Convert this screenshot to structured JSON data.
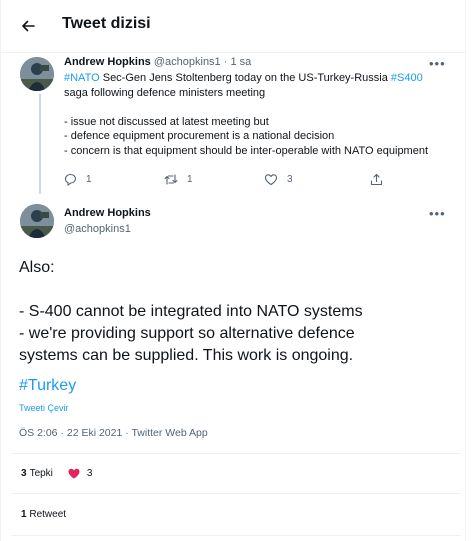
{
  "header": {
    "title": "Tweet dizisi"
  },
  "tweet1": {
    "author_name": "Andrew Hopkins",
    "handle": "@achopkins1",
    "separator": "·",
    "time": "1 sa",
    "line1_tag1": "#NATO",
    "line1_mid": " Sec-Gen Jens Stoltenberg today on the US-Turkey-Russia ",
    "line1_tag2": "#S400",
    "line2": "saga following defence ministers meeting",
    "line3": "- issue not discussed at latest meeting but",
    "line4": "- defence equipment procurement is a national decision",
    "line5": "- concern is that equipment should be inter-operable with NATO equipment",
    "reply_count": "1",
    "retweet_count": "1",
    "like_count": "3"
  },
  "tweet2": {
    "author_name": "Andrew Hopkins",
    "handle": "@achopkins1",
    "line1": "Also:",
    "line2": "- S-400 cannot be integrated into NATO systems",
    "line3": "- we're providing support so alternative defence",
    "line4": "systems can be supplied. This work is ongoing.",
    "hashtag": "#Turkey",
    "translate": "Tweeti Çevir",
    "timestamp": "ÖS 2:06 · 22 Eki 2021 · Twitter Web App",
    "reactions_count": "3",
    "reactions_label": "Tepki",
    "heart_count": "3",
    "retweets_count": "1",
    "retweets_label": "Retweet"
  },
  "colors": {
    "accent": "#1d9bf0",
    "heart": "#f91880",
    "muted": "#536471"
  },
  "icons": {
    "back": "arrow-left-icon",
    "more": "more-horizontal-icon",
    "reply": "reply-icon",
    "retweet": "retweet-icon",
    "like": "heart-icon",
    "share": "share-icon"
  }
}
